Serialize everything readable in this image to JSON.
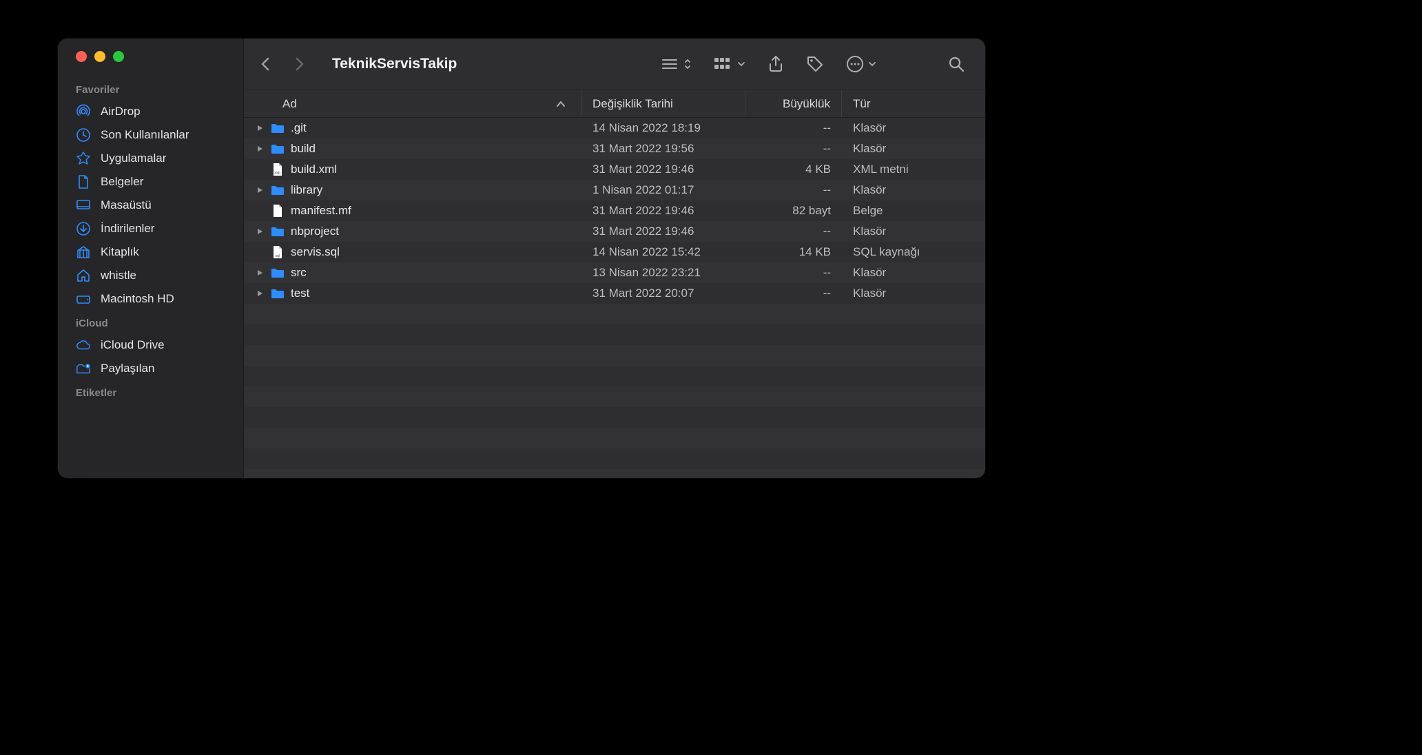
{
  "window": {
    "title": "TeknikServisTakip"
  },
  "sidebar": {
    "sections": [
      {
        "title": "Favoriler",
        "items": [
          {
            "icon": "airdrop",
            "label": "AirDrop"
          },
          {
            "icon": "clock",
            "label": "Son Kullanılanlar"
          },
          {
            "icon": "apps",
            "label": "Uygulamalar"
          },
          {
            "icon": "document",
            "label": "Belgeler"
          },
          {
            "icon": "desktop",
            "label": "Masaüstü"
          },
          {
            "icon": "download",
            "label": "İndirilenler"
          },
          {
            "icon": "library",
            "label": "Kitaplık"
          },
          {
            "icon": "home",
            "label": "whistle"
          },
          {
            "icon": "disk",
            "label": "Macintosh HD"
          }
        ]
      },
      {
        "title": "iCloud",
        "items": [
          {
            "icon": "cloud",
            "label": "iCloud Drive"
          },
          {
            "icon": "shared",
            "label": "Paylaşılan"
          }
        ]
      },
      {
        "title": "Etiketler",
        "items": []
      }
    ]
  },
  "columns": {
    "name": "Ad",
    "date": "Değişiklik Tarihi",
    "size": "Büyüklük",
    "type": "Tür"
  },
  "files": [
    {
      "expandable": true,
      "kind": "folder",
      "name": ".git",
      "date": "14 Nisan 2022 18:19",
      "size": "--",
      "type": "Klasör"
    },
    {
      "expandable": true,
      "kind": "folder",
      "name": "build",
      "date": "31 Mart 2022 19:56",
      "size": "--",
      "type": "Klasör"
    },
    {
      "expandable": false,
      "kind": "xml",
      "name": "build.xml",
      "date": "31 Mart 2022 19:46",
      "size": "4 KB",
      "type": "XML metni"
    },
    {
      "expandable": true,
      "kind": "folder",
      "name": "library",
      "date": "1 Nisan 2022 01:17",
      "size": "--",
      "type": "Klasör"
    },
    {
      "expandable": false,
      "kind": "doc",
      "name": "manifest.mf",
      "date": "31 Mart 2022 19:46",
      "size": "82 bayt",
      "type": "Belge"
    },
    {
      "expandable": true,
      "kind": "folder",
      "name": "nbproject",
      "date": "31 Mart 2022 19:46",
      "size": "--",
      "type": "Klasör"
    },
    {
      "expandable": false,
      "kind": "sql",
      "name": "servis.sql",
      "date": "14 Nisan 2022 15:42",
      "size": "14 KB",
      "type": "SQL kaynağı"
    },
    {
      "expandable": true,
      "kind": "folder",
      "name": "src",
      "date": "13 Nisan 2022 23:21",
      "size": "--",
      "type": "Klasör"
    },
    {
      "expandable": true,
      "kind": "folder",
      "name": "test",
      "date": "31 Mart 2022 20:07",
      "size": "--",
      "type": "Klasör"
    }
  ],
  "empty_rows": 12
}
